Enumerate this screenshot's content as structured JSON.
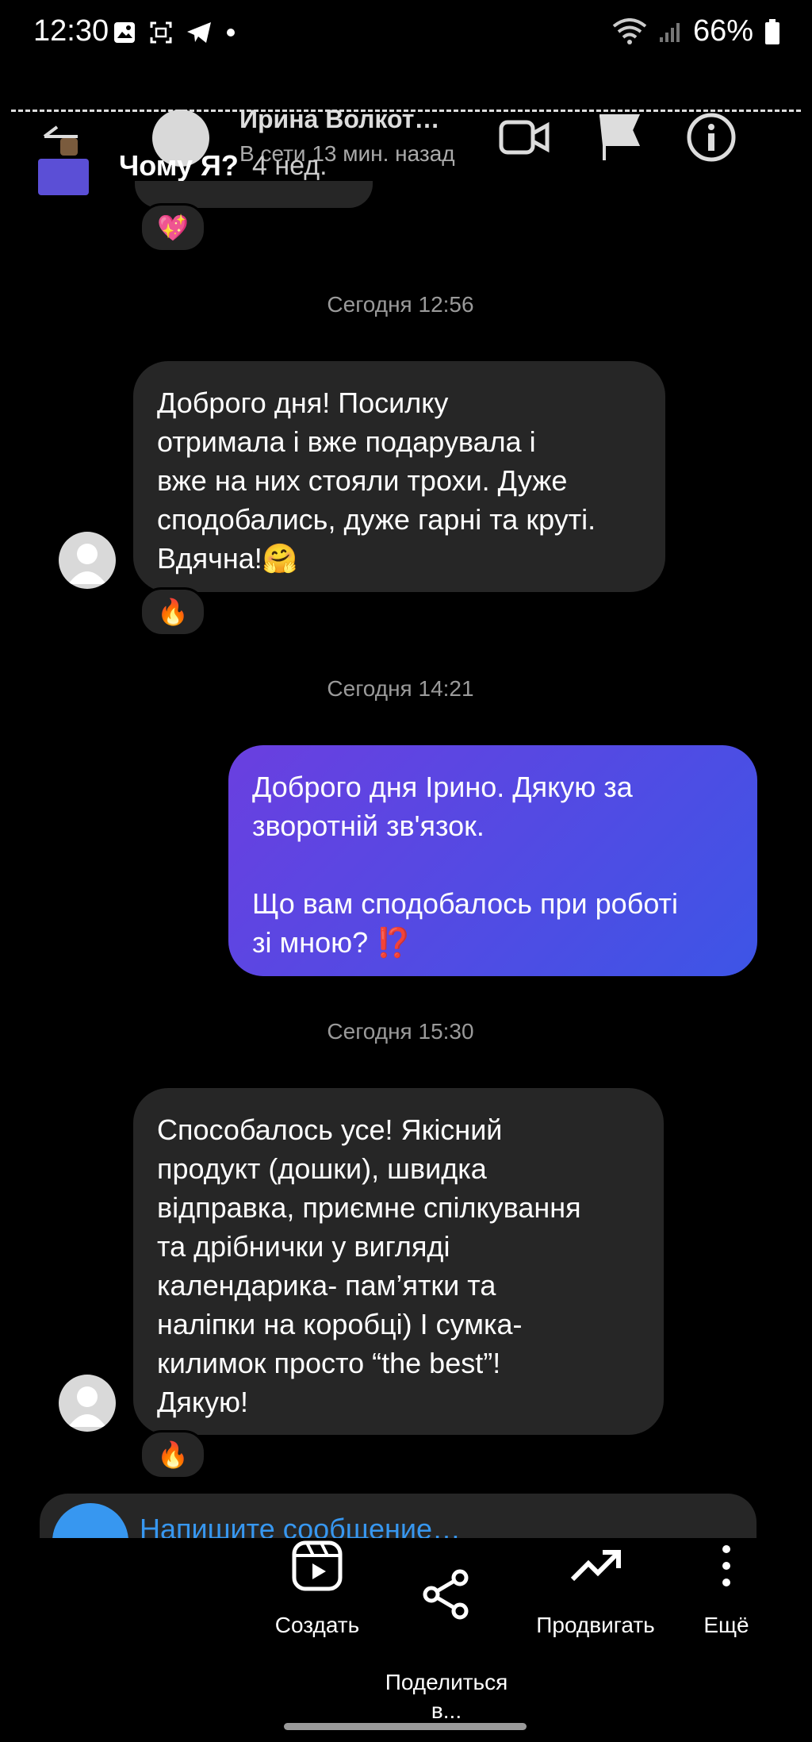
{
  "status": {
    "time": "12:30",
    "battery": "66%"
  },
  "header": {
    "contact_name": "Ирина Волкот…",
    "contact_status": "В сети 13 мин. назад",
    "story_title": "Чому Я?",
    "story_age": "4 нед."
  },
  "messages": [
    {
      "type": "reaction",
      "emoji": "💖"
    },
    {
      "type": "timestamp",
      "text": "Сегодня 12:56"
    },
    {
      "type": "incoming",
      "text": "Доброго дня! Посилку\nотримала і вже подарувала і\nвже на них стояли трохи. Дуже\nсподобались, дуже гарні та круті.\nВдячна!🤗",
      "reaction": "🔥"
    },
    {
      "type": "timestamp",
      "text": "Сегодня 14:21"
    },
    {
      "type": "outgoing",
      "text": "Доброго дня Ірино. Дякую за\nзворотній зв'язок.\n\nЩо вам сподобалось при роботі\nзі мною? ⁉️"
    },
    {
      "type": "timestamp",
      "text": "Сегодня 15:30"
    },
    {
      "type": "incoming",
      "text": "Способалось усе! Якісний\nпродукт (дошки), швидка\nвідправка, приємне спілкування\nта дрібнички у вигляді\nкалендарика- пам’ятки та\nналіпки на коробці) І сумка-\nкилимок просто “the best”!\nДякую!",
      "reaction": "🔥"
    }
  ],
  "composer": {
    "placeholder": "Напишите сообщение…"
  },
  "bottom_actions": [
    {
      "label": "Создать",
      "icon": "reels-icon"
    },
    {
      "label": "Поделиться\nв...",
      "icon": "share-icon"
    },
    {
      "label": "Продвигать",
      "icon": "trending-icon"
    },
    {
      "label": "Ещё",
      "icon": "more-vertical-icon"
    }
  ]
}
